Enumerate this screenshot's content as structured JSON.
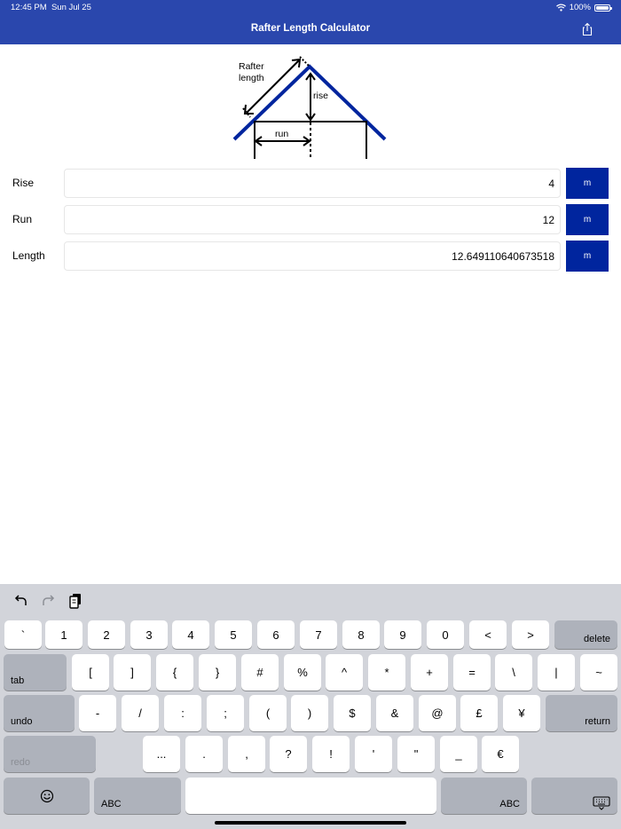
{
  "status": {
    "time": "12:45 PM",
    "date": "Sun Jul 25",
    "battery": "100%"
  },
  "nav": {
    "title": "Rafter Length Calculator"
  },
  "diagram": {
    "rafter_label_1": "Rafter",
    "rafter_label_2": "length",
    "rise_label": "rise",
    "run_label": "run"
  },
  "rows": [
    {
      "label": "Rise",
      "value": "4",
      "unit": "m"
    },
    {
      "label": "Run",
      "value": "12",
      "unit": "m"
    },
    {
      "label": "Length",
      "value": "12.649110640673518",
      "unit": "m"
    }
  ],
  "keyboard": {
    "row1": [
      "`",
      "1",
      "2",
      "3",
      "4",
      "5",
      "6",
      "7",
      "8",
      "9",
      "0",
      "<",
      ">"
    ],
    "delete": "delete",
    "tab": "tab",
    "row2": [
      "[",
      "]",
      "{",
      "}",
      "#",
      "%",
      "^",
      "*",
      "+",
      "=",
      "\\",
      "|",
      "~"
    ],
    "undo": "undo",
    "row3": [
      "-",
      "/",
      ":",
      ";",
      "(",
      ")",
      "$",
      "&",
      "@",
      "£",
      "¥"
    ],
    "return": "return",
    "redo": "redo",
    "row4": [
      "...",
      ".",
      ",",
      "?",
      "!",
      "'",
      "\"",
      "_",
      "€"
    ],
    "abc_left": "ABC",
    "abc_right": "ABC"
  },
  "colors": {
    "nav_bar": "#2a47ad",
    "accent": "#00259e",
    "keyboard_bg": "#d2d4da"
  }
}
